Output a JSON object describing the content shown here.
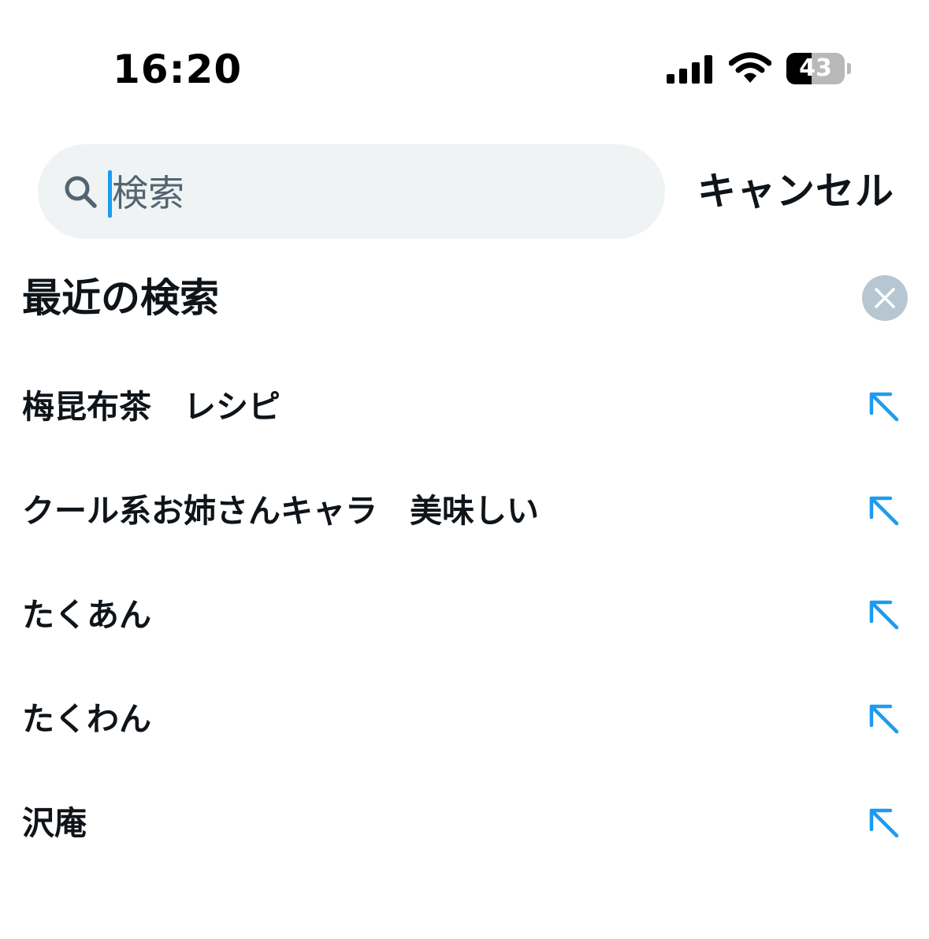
{
  "status_bar": {
    "time": "16:20",
    "battery_level": "43",
    "battery_fraction": 0.43,
    "icons": [
      "signal-icon",
      "wifi-icon",
      "battery-icon"
    ]
  },
  "search": {
    "placeholder": "検索",
    "value": "",
    "cancel_label": "キャンセル"
  },
  "recent": {
    "title": "最近の検索",
    "items": [
      {
        "label": "梅昆布茶　レシピ"
      },
      {
        "label": "クール系お姉さんキャラ　美味しい"
      },
      {
        "label": "たくあん"
      },
      {
        "label": "たくわん"
      },
      {
        "label": "沢庵"
      }
    ]
  },
  "colors": {
    "accent": "#1d9bf0",
    "text": "#0f1419",
    "search_bg": "#eff3f4",
    "clear_button_bg": "#b7c7d1",
    "secondary_text": "#536471"
  }
}
